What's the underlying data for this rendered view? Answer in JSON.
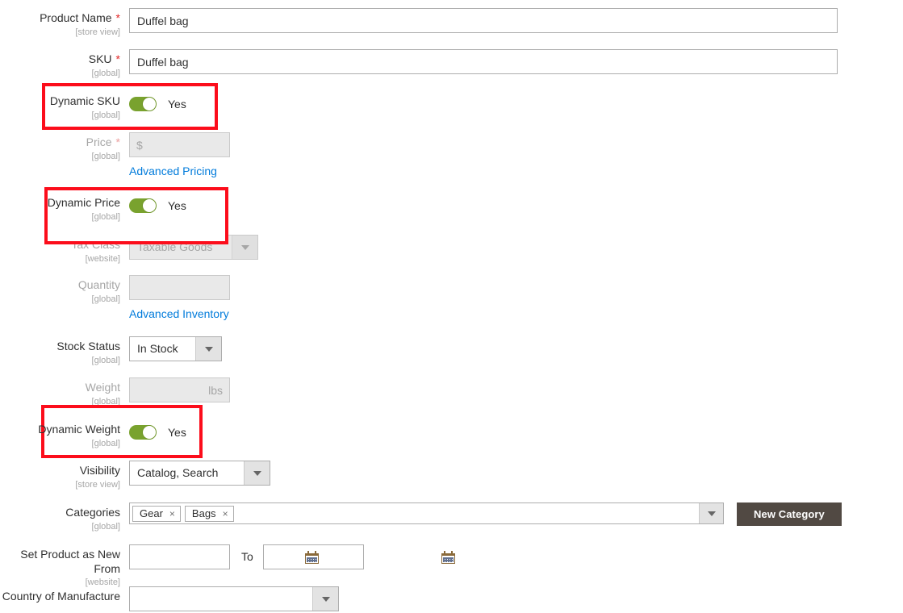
{
  "form": {
    "rows": [
      {
        "id": "product-name",
        "label": "Product Name",
        "scope": "[store view]",
        "required": true,
        "value": "Duffel bag"
      },
      {
        "id": "sku",
        "label": "SKU",
        "scope": "[global]",
        "required": true,
        "value": "Duffel bag"
      },
      {
        "id": "dynamic-sku",
        "label": "Dynamic SKU",
        "scope": "[global]",
        "toggle_state": "Yes"
      },
      {
        "id": "price",
        "label": "Price",
        "scope": "[global]",
        "required": true,
        "currency_symbol": "$",
        "value": "",
        "link": "Advanced Pricing"
      },
      {
        "id": "dynamic-price",
        "label": "Dynamic Price",
        "scope": "[global]",
        "toggle_state": "Yes"
      },
      {
        "id": "tax-class",
        "label": "Tax Class",
        "scope": "[website]",
        "value": "Taxable Goods"
      },
      {
        "id": "quantity",
        "label": "Quantity",
        "scope": "[global]",
        "value": "",
        "link": "Advanced Inventory"
      },
      {
        "id": "stock-status",
        "label": "Stock Status",
        "scope": "[global]",
        "value": "In Stock"
      },
      {
        "id": "weight",
        "label": "Weight",
        "scope": "[global]",
        "value": "",
        "unit": "lbs"
      },
      {
        "id": "dynamic-weight",
        "label": "Dynamic Weight",
        "scope": "[global]",
        "toggle_state": "Yes"
      },
      {
        "id": "visibility",
        "label": "Visibility",
        "scope": "[store view]",
        "value": "Catalog, Search"
      },
      {
        "id": "categories",
        "label": "Categories",
        "scope": "[global]",
        "chips": [
          "Gear",
          "Bags"
        ],
        "button": "New Category"
      },
      {
        "id": "set-product-as-new",
        "label": "Set Product as New From",
        "scope": "[website]",
        "from_value": "",
        "to_label": "To",
        "to_value": ""
      },
      {
        "id": "country-of-manufacture",
        "label": "Country of Manufacture",
        "scope": "",
        "value": ""
      }
    ]
  },
  "icons": {
    "chip_remove": "×",
    "calendar": "calendar-icon",
    "caret_down": "caret-down-icon"
  },
  "colors": {
    "toggle_on": "#79a22e",
    "link": "#007bdb",
    "required_star": "#e22626",
    "button_dark": "#514943",
    "annotation": "#fc0d1b",
    "text": "#303030",
    "muted": "#a6a6a6"
  }
}
